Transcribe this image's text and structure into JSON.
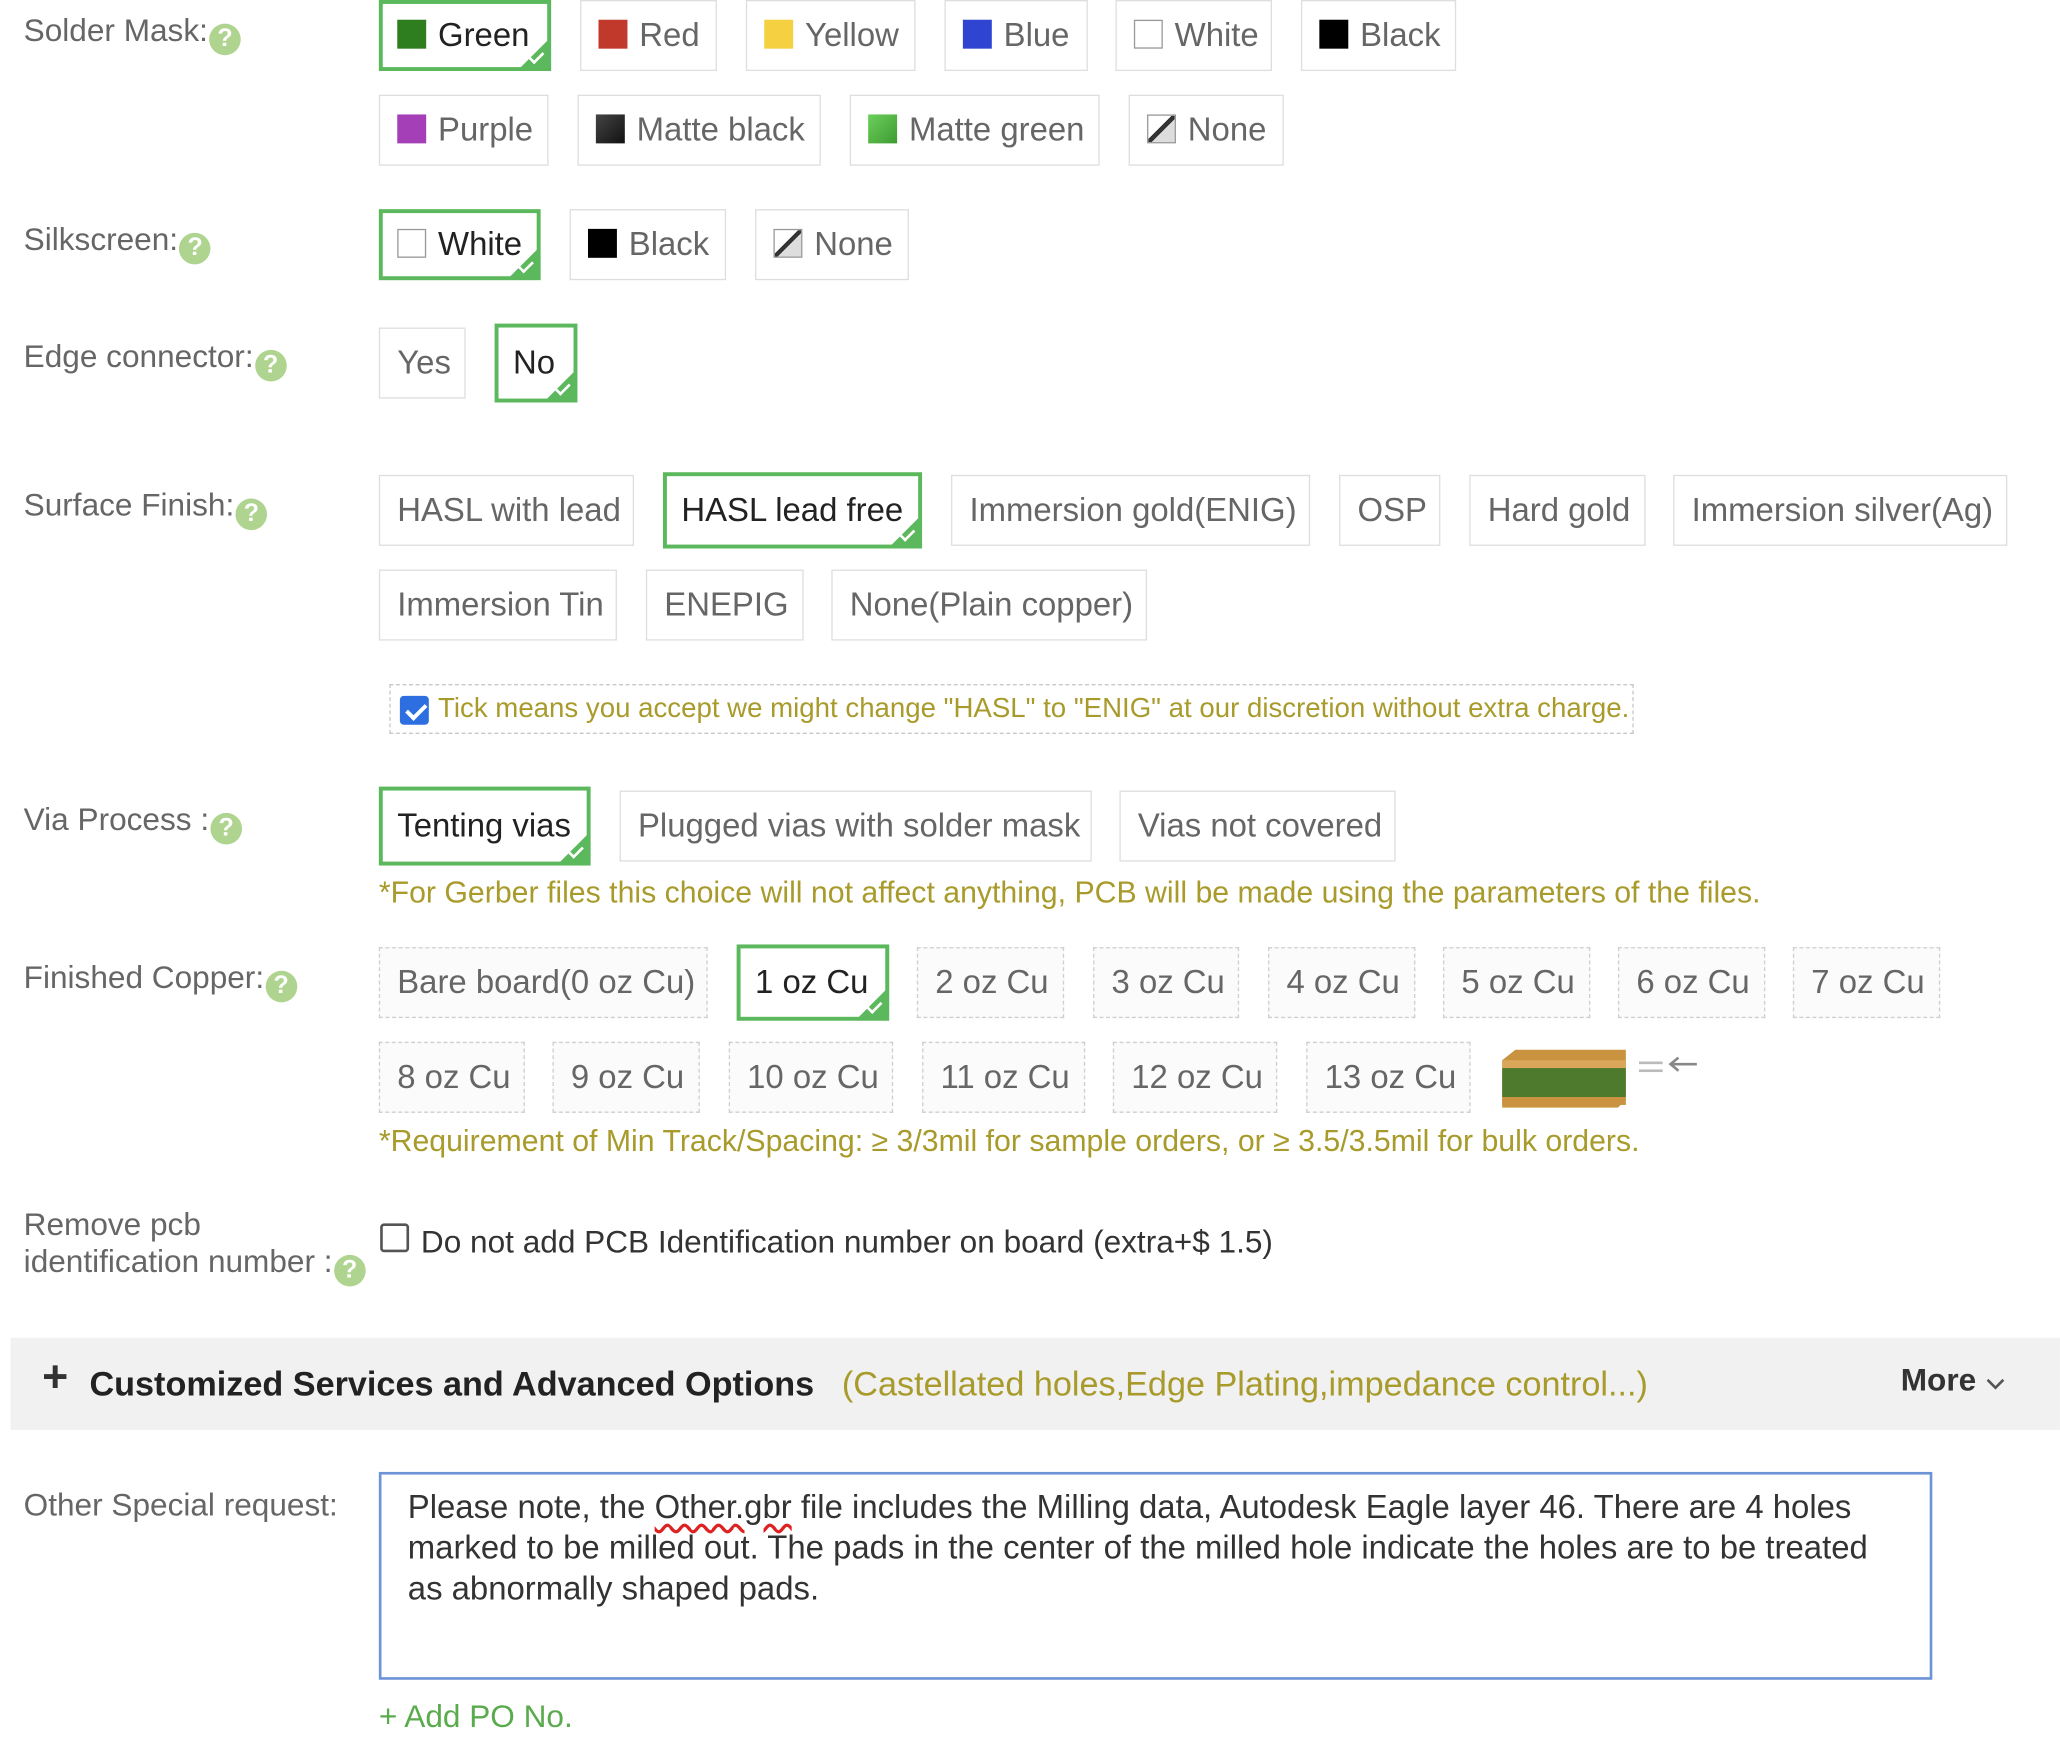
{
  "solder_mask": {
    "label": "Solder Mask:",
    "options": [
      {
        "label": "Green",
        "color": "#2e7d1f"
      },
      {
        "label": "Red",
        "color": "#c0392b"
      },
      {
        "label": "Yellow",
        "color": "#f5d142"
      },
      {
        "label": "Blue",
        "color": "#2f45d1"
      },
      {
        "label": "White",
        "color": "#ffffff"
      },
      {
        "label": "Black",
        "color": "#000000"
      },
      {
        "label": "Purple",
        "color": "#a43fb8"
      },
      {
        "label": "Matte black",
        "color": "#1c1c1c"
      },
      {
        "label": "Matte green",
        "color": "#4caf3e"
      },
      {
        "label": "None",
        "color": "none"
      }
    ],
    "selected": "Green"
  },
  "silkscreen": {
    "label": "Silkscreen:",
    "options": [
      {
        "label": "White",
        "color": "#ffffff"
      },
      {
        "label": "Black",
        "color": "#000000"
      },
      {
        "label": "None",
        "color": "none"
      }
    ],
    "selected": "White"
  },
  "edge_connector": {
    "label": "Edge connector:",
    "options": [
      "Yes",
      "No"
    ],
    "selected": "No"
  },
  "surface_finish": {
    "label": "Surface Finish:",
    "options": [
      "HASL with lead",
      "HASL lead free",
      "Immersion gold(ENIG)",
      "OSP",
      "Hard gold",
      "Immersion silver(Ag)",
      "Immersion Tin",
      "ENEPIG",
      "None(Plain copper)"
    ],
    "selected": "HASL lead free",
    "tick_text": "Tick means you accept we might change \"HASL\" to \"ENIG\" at our discretion without extra charge.",
    "tick_checked": true
  },
  "via_process": {
    "label": "Via Process :",
    "options": [
      "Tenting vias",
      "Plugged vias with solder mask",
      "Vias not covered"
    ],
    "selected": "Tenting vias",
    "note": "*For Gerber files this choice will not affect anything, PCB will be made using the parameters of the files."
  },
  "finished_copper": {
    "label": "Finished Copper:",
    "options": [
      "Bare board(0 oz Cu)",
      "1 oz Cu",
      "2 oz Cu",
      "3 oz Cu",
      "4 oz Cu",
      "5 oz Cu",
      "6 oz Cu",
      "7 oz Cu",
      "8 oz Cu",
      "9 oz Cu",
      "10 oz Cu",
      "11 oz Cu",
      "12 oz Cu",
      "13 oz Cu"
    ],
    "selected": "1 oz Cu",
    "note": "*Requirement of Min Track/Spacing: ≥ 3/3mil for sample orders, or ≥ 3.5/3.5mil for bulk orders."
  },
  "remove_id": {
    "label_line1": "Remove pcb",
    "label_line2": "identification number :",
    "checkbox_text": "Do not add PCB Identification number on board (extra+$ 1.5)",
    "checked": false
  },
  "advanced": {
    "plus": "+",
    "title": "Customized Services and Advanced Options",
    "subtitle": "(Castellated holes,Edge Plating,impedance control...)",
    "more": "More"
  },
  "special_request": {
    "label": "Other Special request:",
    "text_before": "Please note, the ",
    "text_misspelled": "Other.gbr",
    "text_after": " file includes the Milling data, Autodesk Eagle layer 46. There are 4 holes marked to be milled out. The pads in the center of the milled hole indicate the holes are to be treated as abnormally shaped pads."
  },
  "add_po": "+ Add PO No.",
  "help_glyph": "?",
  "colors": {
    "accent_green": "#5cb85c",
    "help_green": "#aed48f",
    "note_olive": "#a89b2c",
    "link_green": "#5aab4d",
    "checkbox_blue": "#2d6ee0"
  }
}
